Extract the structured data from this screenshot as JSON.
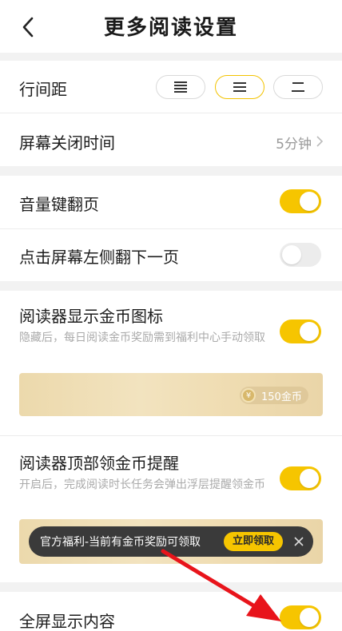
{
  "header": {
    "title": "更多阅读设置",
    "back_icon": "chevron-left-icon"
  },
  "line_spacing": {
    "label": "行间距",
    "options": [
      {
        "icon": "spacing-small-icon",
        "selected": false
      },
      {
        "icon": "spacing-medium-icon",
        "selected": true
      },
      {
        "icon": "spacing-large-icon",
        "selected": false
      }
    ]
  },
  "screen_off": {
    "label": "屏幕关闭时间",
    "value": "5分钟"
  },
  "volume_flip": {
    "label": "音量键翻页",
    "on": true
  },
  "tap_left": {
    "label": "点击屏幕左侧翻下一页",
    "on": false
  },
  "coin_icon_setting": {
    "label": "阅读器显示金币图标",
    "desc": "隐藏后，每日阅读金币奖励需到福利中心手动领取",
    "on": true,
    "preview_coin_symbol": "¥",
    "preview_coin_text": "150金币"
  },
  "coin_reminder": {
    "label": "阅读器顶部领金币提醒",
    "desc": "开启后，完成阅读时长任务会弹出浮层提醒领金币",
    "on": true,
    "preview_text": "官方福利-当前有金币奖励可领取",
    "preview_button": "立即领取"
  },
  "fullscreen": {
    "label": "全屏显示内容",
    "on": true
  },
  "colors": {
    "accent": "#f6c500",
    "arrow": "#e8141b"
  }
}
